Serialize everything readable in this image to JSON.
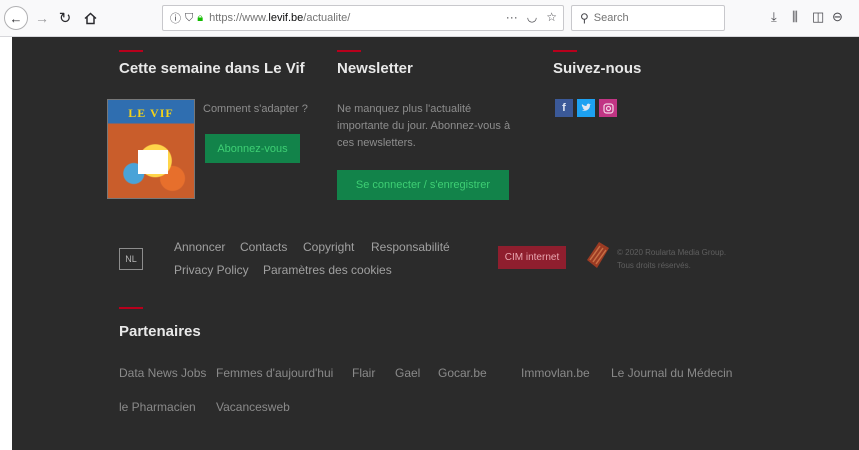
{
  "browser": {
    "url_prefix": "https://www.",
    "url_host": "levif.be",
    "url_path": "/actualite/",
    "search_placeholder": "Search",
    "page_actions_glyph": "···"
  },
  "footer": {
    "magazine": {
      "heading": "Cette semaine dans Le Vif",
      "cover_masthead": "LE VIF",
      "question": "Comment s'adapter ?",
      "subscribe_button": "Abonnez-vous"
    },
    "newsletter": {
      "heading": "Newsletter",
      "text_line1": "Ne manquez plus l'actualité",
      "text_line2": "importante du jour. Abonnez-vous à",
      "text_line3": "ces newsletters.",
      "connect_button": "Se connecter / s'enregistrer"
    },
    "social": {
      "heading": "Suivez-nous",
      "icons": [
        "facebook-icon",
        "twitter-icon",
        "instagram-icon"
      ]
    },
    "language_button": "NL",
    "links": {
      "annoncer": "Annoncer",
      "contacts": "Contacts",
      "copyright": "Copyright",
      "responsabilite": "Responsabilité",
      "privacy": "Privacy Policy",
      "cookies": "Paramètres des cookies"
    },
    "cim_logo": "CIM internet",
    "copyright_line1": "© 2020 Roularta Media Group.",
    "copyright_line2": "Tous droits réservés.",
    "partners": {
      "heading": "Partenaires",
      "items": [
        "Data News Jobs",
        "Femmes d'aujourd'hui",
        "Flair",
        "Gael",
        "Gocar.be",
        "Immovlan.be",
        "Le Journal du Médecin",
        "le Pharmacien",
        "Vacancesweb"
      ]
    }
  },
  "colors": {
    "accent": "#b8001c",
    "background": "#2b2b2b",
    "button_green": "#12834a",
    "facebook": "#3b5998",
    "twitter": "#1da1f2",
    "instagram": "#c13584"
  }
}
